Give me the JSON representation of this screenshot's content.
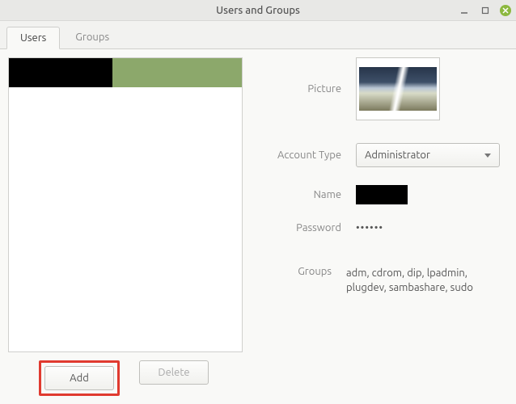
{
  "window": {
    "title": "Users and Groups"
  },
  "tabs": {
    "users": "Users",
    "groups": "Groups",
    "active": "users"
  },
  "buttons": {
    "add": "Add",
    "delete": "Delete"
  },
  "labels": {
    "picture": "Picture",
    "account_type": "Account Type",
    "name": "Name",
    "password": "Password",
    "groups": "Groups"
  },
  "details": {
    "account_type_value": "Administrator",
    "password_value": "••••••",
    "groups_value": "adm, cdrom, dip, lpadmin, plugdev, sambashare, sudo"
  }
}
